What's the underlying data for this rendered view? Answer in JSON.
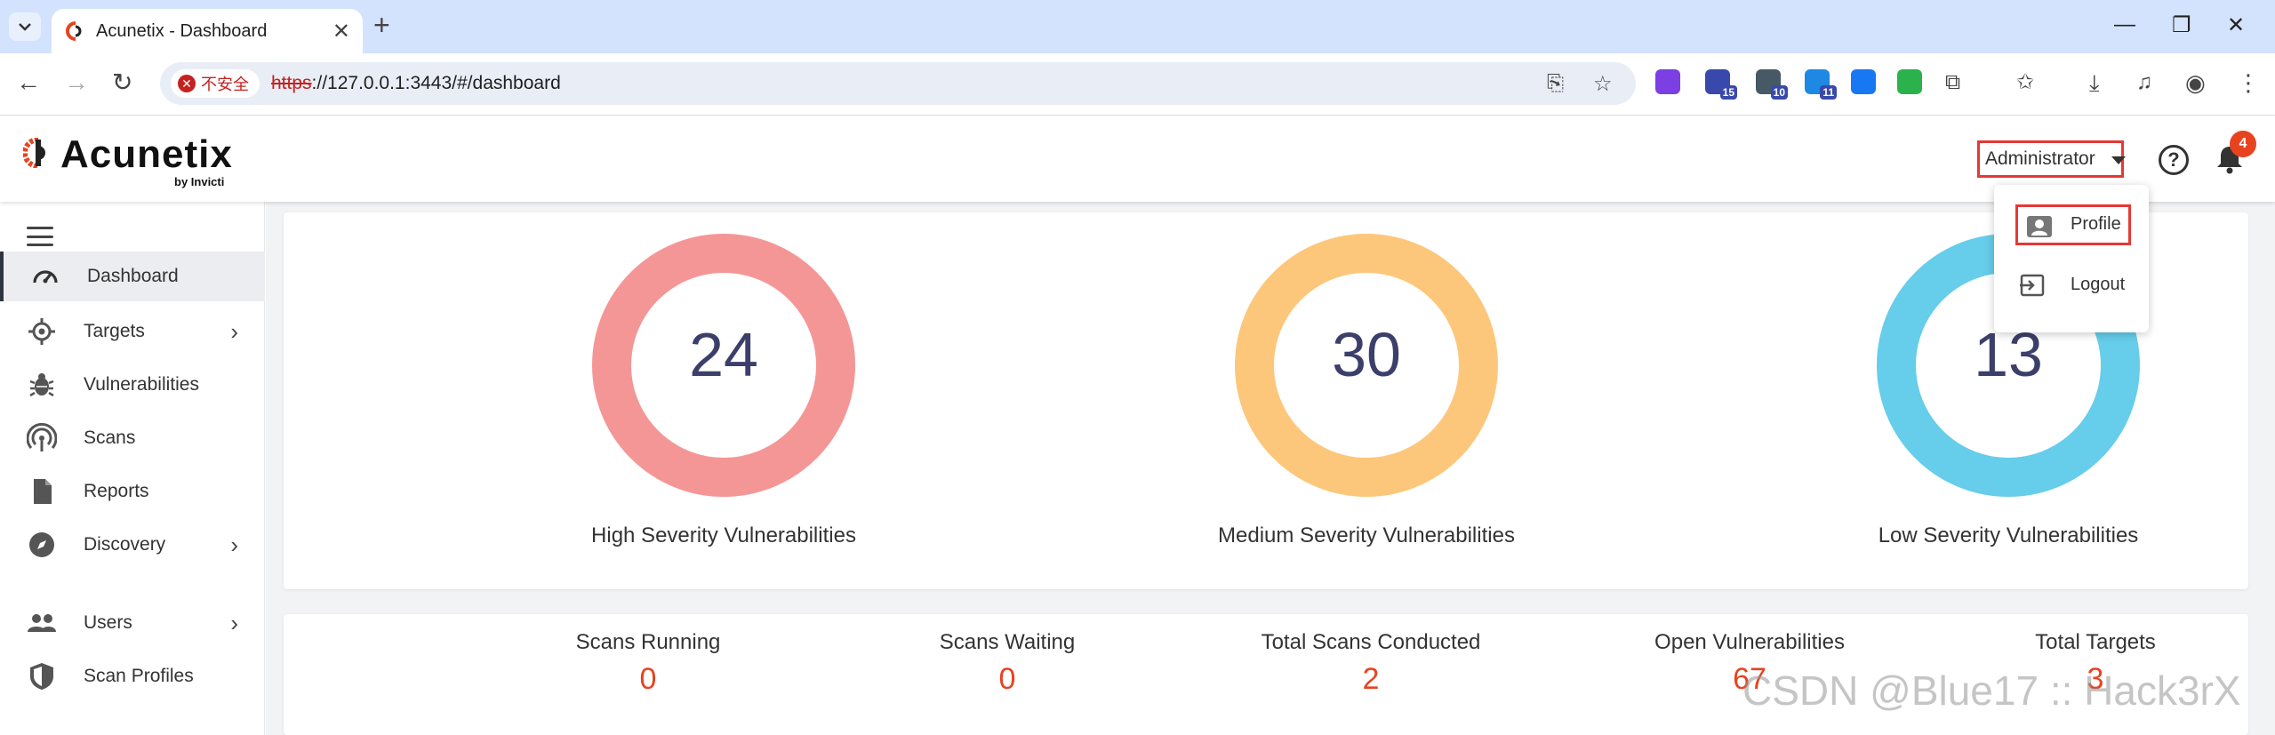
{
  "browser": {
    "tab_title": "Acunetix - Dashboard",
    "insecure_label": "不安全",
    "url_protocol": "https",
    "url_rest": "://127.0.0.1:3443/#/dashboard",
    "extensions": [
      {
        "icon": "code-extension-icon",
        "color": "#7b3fe4",
        "badge": ""
      },
      {
        "icon": "house-extension-icon",
        "color": "#3949ab",
        "badge": "15"
      },
      {
        "icon": "timer-extension-icon",
        "color": "#455a64",
        "badge": "10"
      },
      {
        "icon": "calendar-extension-icon",
        "color": "#1e88e5",
        "badge": "11"
      },
      {
        "icon": "butterfly-extension-icon",
        "color": "#1877f2",
        "badge": ""
      },
      {
        "icon": "check-extension-icon",
        "color": "#2bb24c",
        "badge": ""
      }
    ]
  },
  "header": {
    "logo_text": "Acunetix",
    "logo_sub": "by Invicti",
    "admin_label": "Administrator",
    "notification_count": "4"
  },
  "dropdown": {
    "profile_label": "Profile",
    "logout_label": "Logout"
  },
  "sidebar": {
    "items": [
      {
        "label": "Dashboard",
        "icon": "dashboard-gauge-icon",
        "active": true,
        "chevron": false
      },
      {
        "label": "Targets",
        "icon": "target-crosshair-icon",
        "active": false,
        "chevron": true
      },
      {
        "label": "Vulnerabilities",
        "icon": "bug-icon",
        "active": false,
        "chevron": false
      },
      {
        "label": "Scans",
        "icon": "scan-radar-icon",
        "active": false,
        "chevron": false
      },
      {
        "label": "Reports",
        "icon": "report-document-icon",
        "active": false,
        "chevron": false
      },
      {
        "label": "Discovery",
        "icon": "compass-icon",
        "active": false,
        "chevron": true
      },
      {
        "label": "Users",
        "icon": "users-icon",
        "active": false,
        "chevron": true
      },
      {
        "label": "Scan Profiles",
        "icon": "shield-icon",
        "active": false,
        "chevron": false
      }
    ]
  },
  "severity": [
    {
      "count": "24",
      "label": "High Severity Vulnerabilities",
      "color": "#f59696"
    },
    {
      "count": "30",
      "label": "Medium Severity Vulnerabilities",
      "color": "#fdc77b"
    },
    {
      "count": "13",
      "label": "Low Severity Vulnerabilities",
      "color": "#66cdea"
    }
  ],
  "stats": [
    {
      "label": "Scans Running",
      "value": "0"
    },
    {
      "label": "Scans Waiting",
      "value": "0"
    },
    {
      "label": "Total Scans Conducted",
      "value": "2"
    },
    {
      "label": "Open Vulnerabilities",
      "value": "67"
    },
    {
      "label": "Total Targets",
      "value": "3"
    }
  ],
  "watermark": "CSDN @Blue17 :: Hack3rX",
  "colors": {
    "accent_red": "#e8431f",
    "highlight_box": "#e53935",
    "tabbar": "#d3e3fd"
  }
}
